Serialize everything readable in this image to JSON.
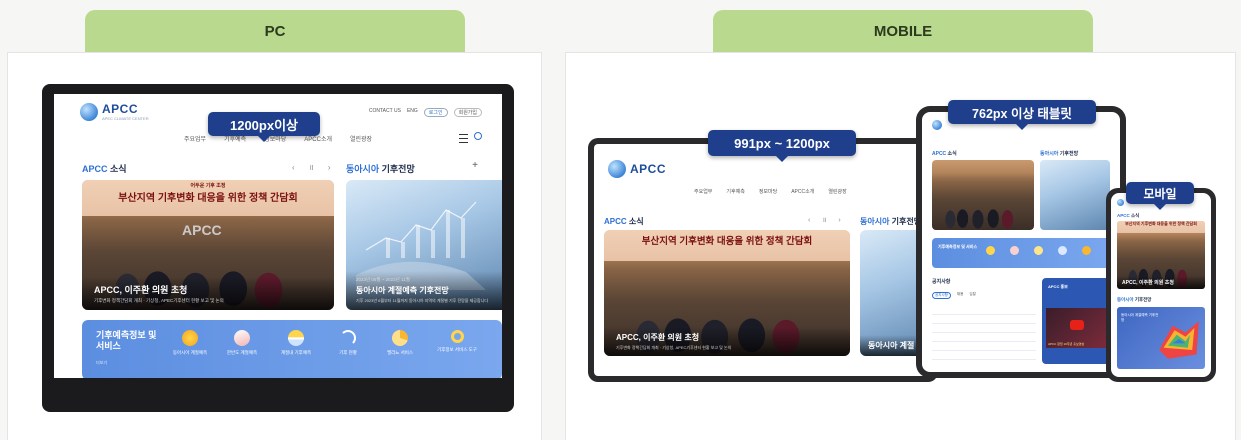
{
  "tabs": {
    "pc": "PC",
    "mobile": "MOBILE"
  },
  "brand": {
    "logo": "APCC",
    "logo_sub": "APEC CLIMATE CENTER"
  },
  "badges": {
    "pc": "1200px이상",
    "laptop": "991px ~ 1200px",
    "tablet": "762px 이상 태블릿",
    "mobile": "모바일"
  },
  "header": {
    "menu": [
      "주요업무",
      "기후예측",
      "정보마당",
      "APCC소개",
      "열린광장"
    ],
    "utils": [
      "CONTACT US",
      "ENG",
      "로그인",
      "회원가입"
    ]
  },
  "news": {
    "title_prefix": "APCC",
    "title_suffix": " 소식",
    "banner_small": "어두운 기후 조정",
    "banner_main": "부산지역 기후변화 대응을 위한 정책 간담회",
    "caption_title": "APCC, 이주환 의원 초청",
    "caption_sub": "기후변화 정책간담회 개최 · 기상청, APEC기후센터 현황 보고 및 논의"
  },
  "forecast": {
    "title_prefix": "동아시아",
    "title_suffix": " 기후전망",
    "period": "2023년 06월 ~ 2023년 11월",
    "caption_title": "동아시아 계절예측 기후전망",
    "caption_title_cut": "동아시아 계절",
    "caption_sub": "기후 2023년 6월부터 11월까지 동아시아 지역의 계절별 기후 전망을 제공합니다"
  },
  "services": {
    "title": "기후예측정보 및 서비스",
    "more": "더보기",
    "items": [
      {
        "label": "동아시아 계절예측",
        "icon": "sun-icon"
      },
      {
        "label": "한반도 계절예측",
        "icon": "sailboat-icon"
      },
      {
        "label": "계절내 기후예측",
        "icon": "waves-icon"
      },
      {
        "label": "기후 현황",
        "icon": "wind-icon"
      },
      {
        "label": "엘리뇨 서비스",
        "icon": "pie-icon"
      },
      {
        "label": "기후정보 서비스 도구",
        "icon": "search-icon"
      }
    ]
  },
  "mobile_extra": {
    "notice_title": "공지사항",
    "notice_tabs": [
      "공지사항",
      "채용",
      "입찰"
    ],
    "apcc_tv": "APCC 홍보",
    "video_caption": "APCC 창립 10주년 홍보영상"
  },
  "colors": {
    "accent": "#2d6fd3",
    "badge": "#1f3f8c",
    "tab": "#b9d98f"
  }
}
